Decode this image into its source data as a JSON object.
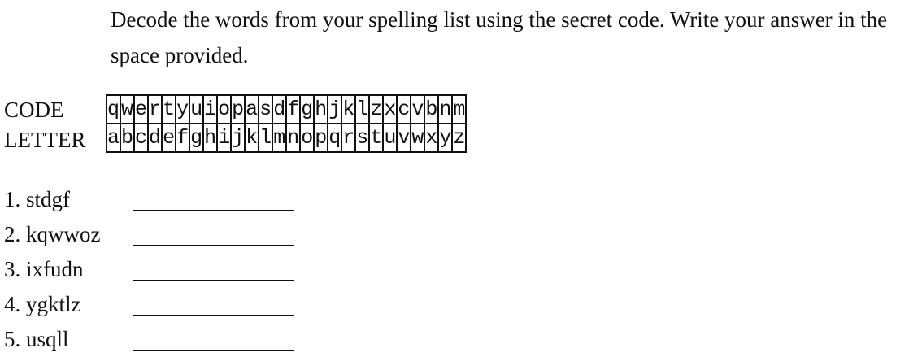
{
  "instructions": "Decode the words from your spelling list using the secret code. Write your answer in the space provided.",
  "labels": {
    "code": "CODE",
    "letter": "LETTER"
  },
  "code_row": [
    "q",
    "w",
    "e",
    "r",
    "t",
    "y",
    "u",
    "i",
    "o",
    "p",
    "a",
    "s",
    "d",
    "f",
    "g",
    "h",
    "j",
    "k",
    "l",
    "z",
    "x",
    "c",
    "v",
    "b",
    "n",
    "m"
  ],
  "letter_row": [
    "a",
    "b",
    "c",
    "d",
    "e",
    "f",
    "g",
    "h",
    "i",
    "j",
    "k",
    "l",
    "m",
    "n",
    "o",
    "p",
    "q",
    "r",
    "s",
    "t",
    "u",
    "v",
    "w",
    "x",
    "y",
    "z"
  ],
  "questions": [
    {
      "number": "1.",
      "word": "stdgf"
    },
    {
      "number": "2.",
      "word": "kqwwoz"
    },
    {
      "number": "3.",
      "word": "ixfudn"
    },
    {
      "number": "4.",
      "word": "ygktlz"
    },
    {
      "number": "5.",
      "word": "usqll"
    }
  ]
}
